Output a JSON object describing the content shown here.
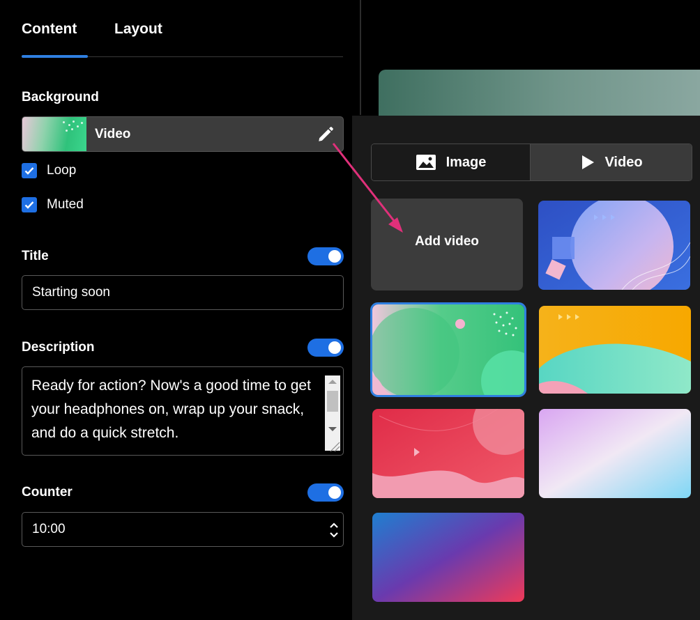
{
  "tabs": {
    "content": "Content",
    "layout": "Layout"
  },
  "background": {
    "label": "Background",
    "type_value": "Video",
    "loop_label": "Loop",
    "muted_label": "Muted",
    "loop_checked": true,
    "muted_checked": true
  },
  "title_section": {
    "label": "Title",
    "value": "Starting soon",
    "enabled": true
  },
  "description_section": {
    "label": "Description",
    "value": "Ready for action? Now's a good time to get your headphones on, wrap up your snack, and do a quick stretch.",
    "enabled": true
  },
  "counter_section": {
    "label": "Counter",
    "value": "10:00",
    "enabled": true
  },
  "media_picker": {
    "tab_image": "Image",
    "tab_video": "Video",
    "active_tab": "Video",
    "add_video_label": "Add video"
  },
  "colors": {
    "accent": "#1e6fe3",
    "panel_bg": "#1a1a1a",
    "arrow": "#e0307a"
  }
}
